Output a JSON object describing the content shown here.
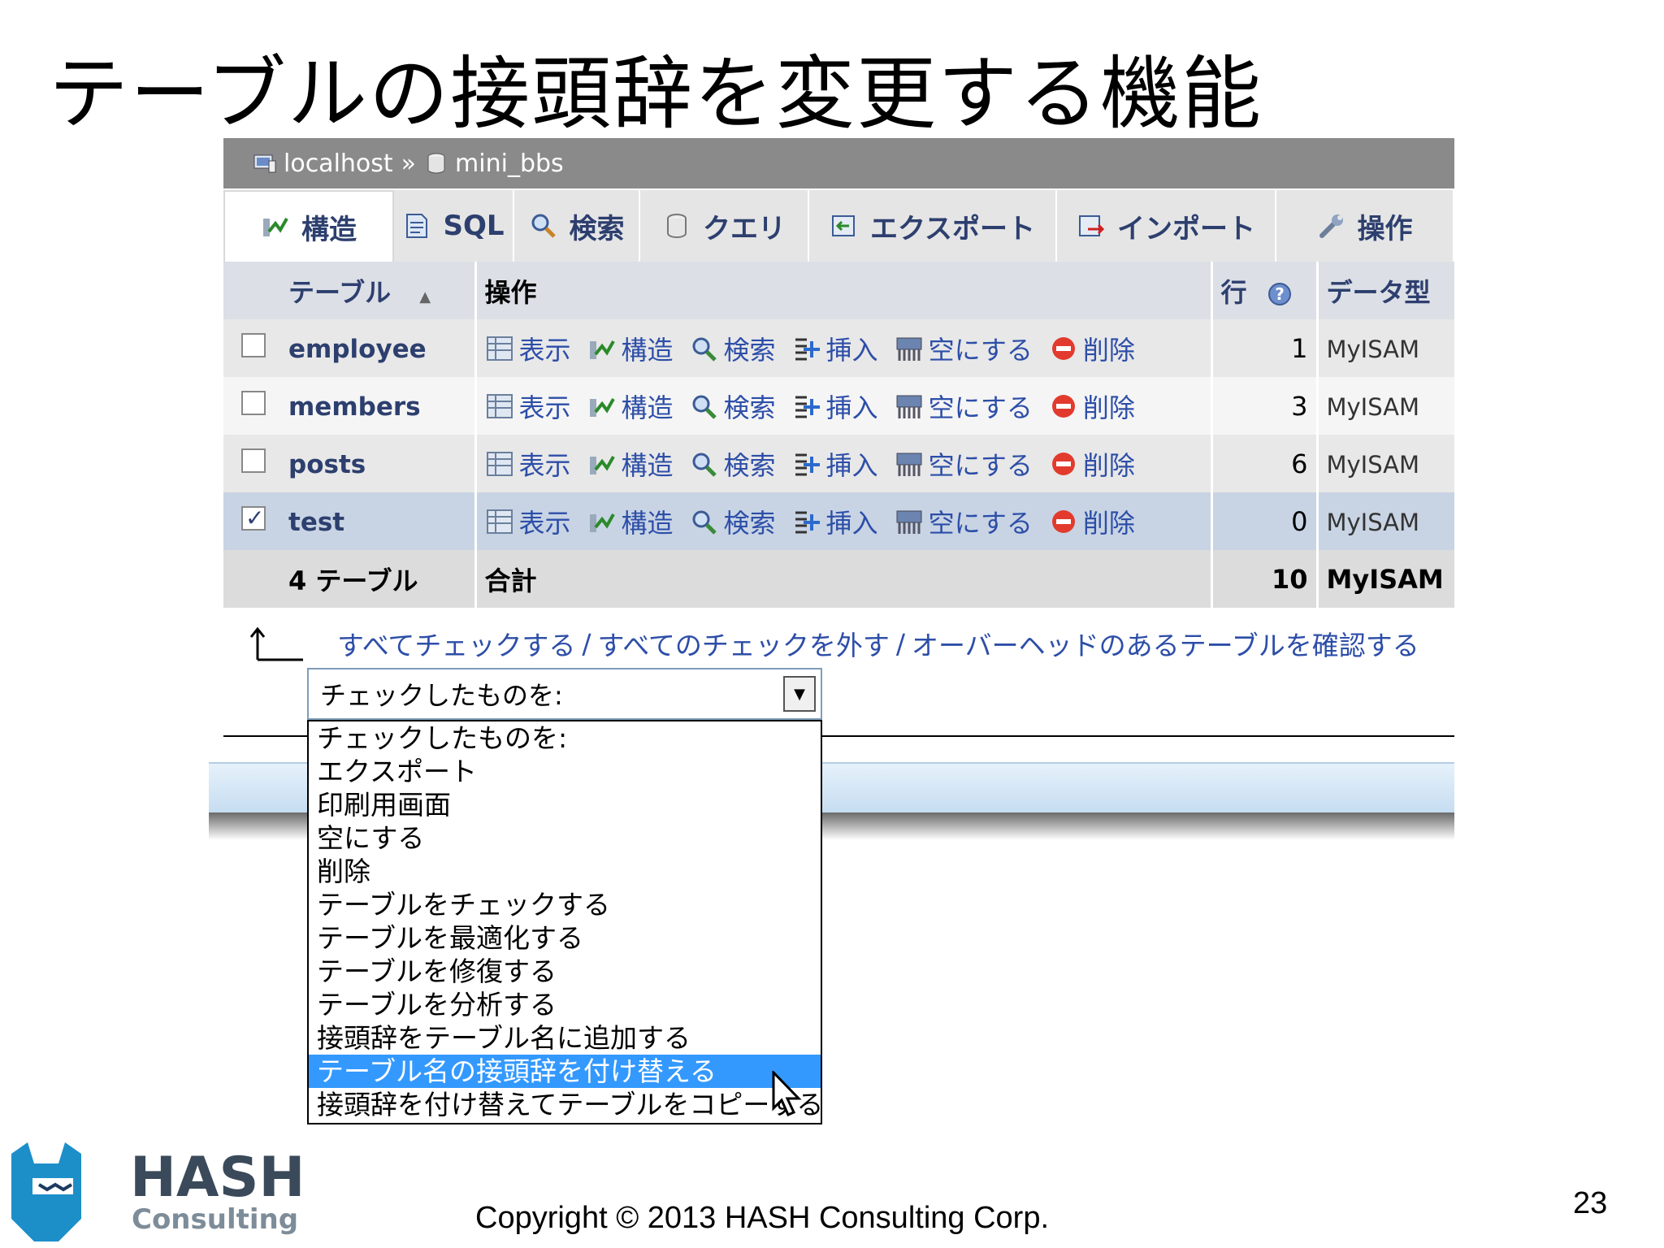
{
  "slide": {
    "title": "テーブルの接頭辞を変更する機能",
    "copyright": "Copyright © 2013 HASH Consulting Corp.",
    "page_number": "23",
    "logo_text_top": "HASH",
    "logo_text_bottom": "Consulting"
  },
  "breadcrumb": {
    "server": "localhost",
    "separator": "»",
    "database": "mini_bbs"
  },
  "tabs": [
    {
      "label": "構造",
      "icon": "structure-icon"
    },
    {
      "label": "SQL",
      "icon": "sql-icon"
    },
    {
      "label": "検索",
      "icon": "search-icon"
    },
    {
      "label": "クエリ",
      "icon": "query-icon"
    },
    {
      "label": "エクスポート",
      "icon": "export-icon"
    },
    {
      "label": "インポート",
      "icon": "import-icon"
    },
    {
      "label": "操作",
      "icon": "wrench-icon"
    }
  ],
  "table": {
    "headers": {
      "table": "テーブル",
      "sort": "▲",
      "ops": "操作",
      "rows": "行",
      "type": "データ型"
    },
    "actions": [
      "表示",
      "構造",
      "検索",
      "挿入",
      "空にする",
      "削除"
    ],
    "rows": [
      {
        "name": "employee",
        "rows": "1",
        "type": "MyISAM",
        "checked": false
      },
      {
        "name": "members",
        "rows": "3",
        "type": "MyISAM",
        "checked": false
      },
      {
        "name": "posts",
        "rows": "6",
        "type": "MyISAM",
        "checked": false
      },
      {
        "name": "test",
        "rows": "0",
        "type": "MyISAM",
        "checked": true
      }
    ],
    "footer": {
      "count": "4 テーブル",
      "label": "合計",
      "rows": "10",
      "type": "MyISAM"
    }
  },
  "check_links": {
    "check_all": "すべてチェックする",
    "uncheck_all": "すべてのチェックを外す",
    "overhead": "オーバーヘッドのあるテーブルを確認する",
    "separator": "/"
  },
  "with_selected": {
    "selected": "チェックしたものを:",
    "options": [
      "チェックしたものを:",
      "エクスポート",
      "印刷用画面",
      "空にする",
      "削除",
      "テーブルをチェックする",
      "テーブルを最適化する",
      "テーブルを修復する",
      "テーブルを分析する",
      "接頭辞をテーブル名に追加する",
      "テーブル名の接頭辞を付け替える",
      "接頭辞を付け替えてテーブルをコピーする"
    ],
    "highlighted_index": 10
  },
  "colors": {
    "link": "#2d4ea8",
    "header_bg": "#dcdfe6",
    "highlight": "#3399ff",
    "selected_row": "#c8d4e4"
  }
}
